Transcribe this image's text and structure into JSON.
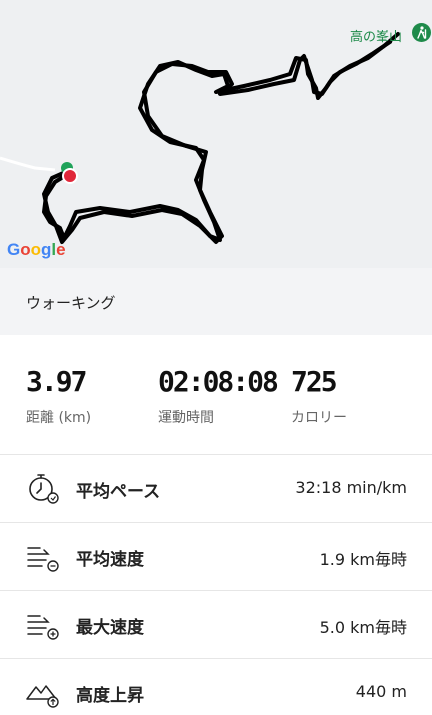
{
  "map": {
    "poi_label": "高の峯山",
    "attribution": "Google",
    "attribution_colors": [
      "#4285F4",
      "#EA4335",
      "#FBBC05",
      "#4285F4",
      "#34A853",
      "#EA4335"
    ]
  },
  "activity": {
    "name": "ウォーキング"
  },
  "stats": [
    {
      "value": "3.97",
      "label": "距離 (km)"
    },
    {
      "value": "02:08:08",
      "label": "運動時間"
    },
    {
      "value": "725",
      "label": "カロリー"
    }
  ],
  "metrics": [
    {
      "icon": "stopwatch-icon",
      "name": "平均ペース",
      "value": "32:18 min/km"
    },
    {
      "icon": "average-speed-icon",
      "name": "平均速度",
      "value": "1.9 km毎時"
    },
    {
      "icon": "max-speed-icon",
      "name": "最大速度",
      "value": "5.0 km毎時"
    },
    {
      "icon": "elevation-gain-icon",
      "name": "高度上昇",
      "value": "440 m"
    }
  ],
  "colors": {
    "route": "#000000",
    "start_marker": "#1fa35a",
    "end_marker": "#e0283a",
    "poi": "#1e8a4a"
  }
}
